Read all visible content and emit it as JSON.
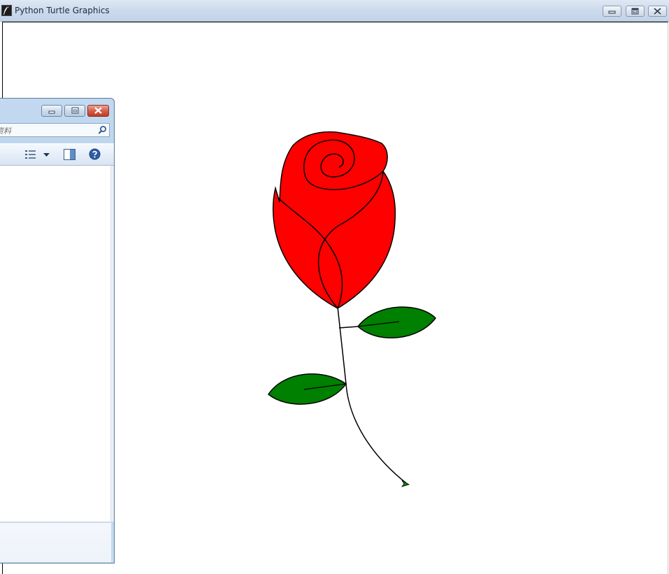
{
  "main_window": {
    "title": "Python Turtle Graphics",
    "minimize_icon": "minimize-icon",
    "maximize_icon": "restore-icon",
    "close_icon": "close-icon"
  },
  "explorer_window": {
    "search_placeholder": "资料",
    "search_icon": "search-icon",
    "toolbar_icons": [
      "view-options-icon",
      "dropdown-arrow-icon",
      "preview-pane-icon",
      "help-icon"
    ],
    "close_button_color": "#c8462d"
  },
  "drawing": {
    "subject": "rose",
    "colors": {
      "petals": "#ff0000",
      "leaves": "#008000",
      "outline": "#000000",
      "turtle_cursor": "#008000"
    }
  }
}
